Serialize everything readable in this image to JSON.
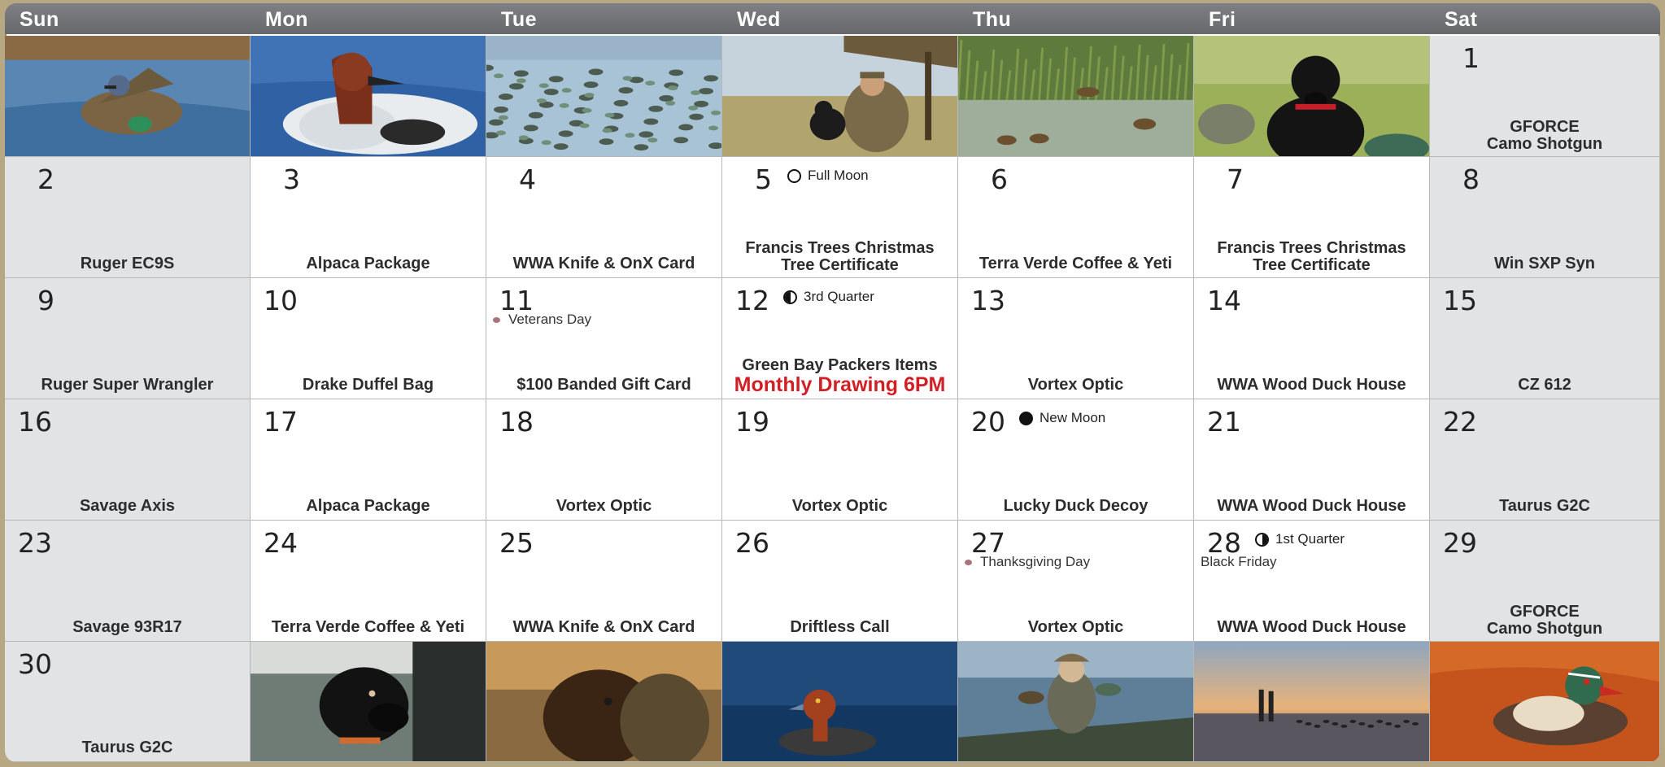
{
  "calendar": {
    "weekdays": [
      "Sun",
      "Mon",
      "Tue",
      "Wed",
      "Thu",
      "Fri",
      "Sat"
    ],
    "weeks": [
      [
        {
          "type": "photo",
          "photo": "blue-winged-teal-photo"
        },
        {
          "type": "photo",
          "photo": "canvasback-duck-photo"
        },
        {
          "type": "photo",
          "photo": "duck-flock-photo"
        },
        {
          "type": "photo",
          "photo": "hunter-with-dog-photo"
        },
        {
          "type": "photo",
          "photo": "marsh-ducks-photo"
        },
        {
          "type": "photo",
          "photo": "black-lab-photo"
        },
        {
          "type": "day",
          "day": "1",
          "prize": "GFORCE\nCamo Shotgun"
        }
      ],
      [
        {
          "type": "day",
          "day": "2",
          "prize": "Ruger EC9S"
        },
        {
          "type": "day",
          "day": "3",
          "prize": "Alpaca Package"
        },
        {
          "type": "day",
          "day": "4",
          "prize": "WWA Knife & OnX Card"
        },
        {
          "type": "day",
          "day": "5",
          "moon": "Full Moon",
          "moon_icon": "full-moon-icon",
          "prize": "Francis Trees Christmas\nTree Certificate"
        },
        {
          "type": "day",
          "day": "6",
          "prize": "Terra Verde Coffee & Yeti"
        },
        {
          "type": "day",
          "day": "7",
          "prize": "Francis Trees Christmas\nTree Certificate"
        },
        {
          "type": "day",
          "day": "8",
          "prize": "Win SXP Syn"
        }
      ],
      [
        {
          "type": "day",
          "day": "9",
          "prize": "Ruger Super Wrangler"
        },
        {
          "type": "day",
          "day": "10",
          "prize": "Drake Duffel Bag"
        },
        {
          "type": "day",
          "day": "11",
          "holiday": "Veterans Day",
          "prize": "$100 Banded Gift Card"
        },
        {
          "type": "day",
          "day": "12",
          "moon": "3rd Quarter",
          "moon_icon": "third-quarter-moon-icon",
          "prize": "Green Bay Packers Items",
          "drawing": "Monthly Drawing 6PM"
        },
        {
          "type": "day",
          "day": "13",
          "prize": "Vortex Optic"
        },
        {
          "type": "day",
          "day": "14",
          "prize": "WWA Wood Duck House"
        },
        {
          "type": "day",
          "day": "15",
          "prize": "CZ 612"
        }
      ],
      [
        {
          "type": "day",
          "day": "16",
          "prize": "Savage Axis"
        },
        {
          "type": "day",
          "day": "17",
          "prize": "Alpaca Package"
        },
        {
          "type": "day",
          "day": "18",
          "prize": "Vortex Optic"
        },
        {
          "type": "day",
          "day": "19",
          "prize": "Vortex Optic"
        },
        {
          "type": "day",
          "day": "20",
          "moon": "New Moon",
          "moon_icon": "new-moon-icon",
          "prize": "Lucky Duck Decoy"
        },
        {
          "type": "day",
          "day": "21",
          "prize": "WWA Wood Duck House"
        },
        {
          "type": "day",
          "day": "22",
          "prize": "Taurus G2C"
        }
      ],
      [
        {
          "type": "day",
          "day": "23",
          "prize": "Savage 93R17"
        },
        {
          "type": "day",
          "day": "24",
          "prize": "Terra Verde Coffee & Yeti"
        },
        {
          "type": "day",
          "day": "25",
          "prize": "WWA Knife & OnX Card"
        },
        {
          "type": "day",
          "day": "26",
          "prize": "Driftless Call"
        },
        {
          "type": "day",
          "day": "27",
          "holiday": "Thanksgiving Day",
          "prize": "Vortex Optic"
        },
        {
          "type": "day",
          "day": "28",
          "moon": "1st Quarter",
          "moon_icon": "first-quarter-moon-icon",
          "note": "Black Friday",
          "prize": "WWA Wood Duck House"
        },
        {
          "type": "day",
          "day": "29",
          "prize": "GFORCE\nCamo Shotgun"
        }
      ],
      [
        {
          "type": "day",
          "day": "30",
          "prize": "Taurus G2C"
        },
        {
          "type": "photo",
          "photo": "lab-puppy-in-truck-photo"
        },
        {
          "type": "photo",
          "photo": "chocolate-lab-photo"
        },
        {
          "type": "photo",
          "photo": "redhead-duck-photo"
        },
        {
          "type": "photo",
          "photo": "hunter-in-boat-photo"
        },
        {
          "type": "photo",
          "photo": "sunset-lake-photo"
        },
        {
          "type": "photo",
          "photo": "wood-duck-photo"
        }
      ]
    ]
  },
  "colors": {
    "header_bg": "#737578",
    "weekend_bg": "#e2e3e4",
    "drawing_red": "#d01f25",
    "frame": "#b7a782"
  }
}
